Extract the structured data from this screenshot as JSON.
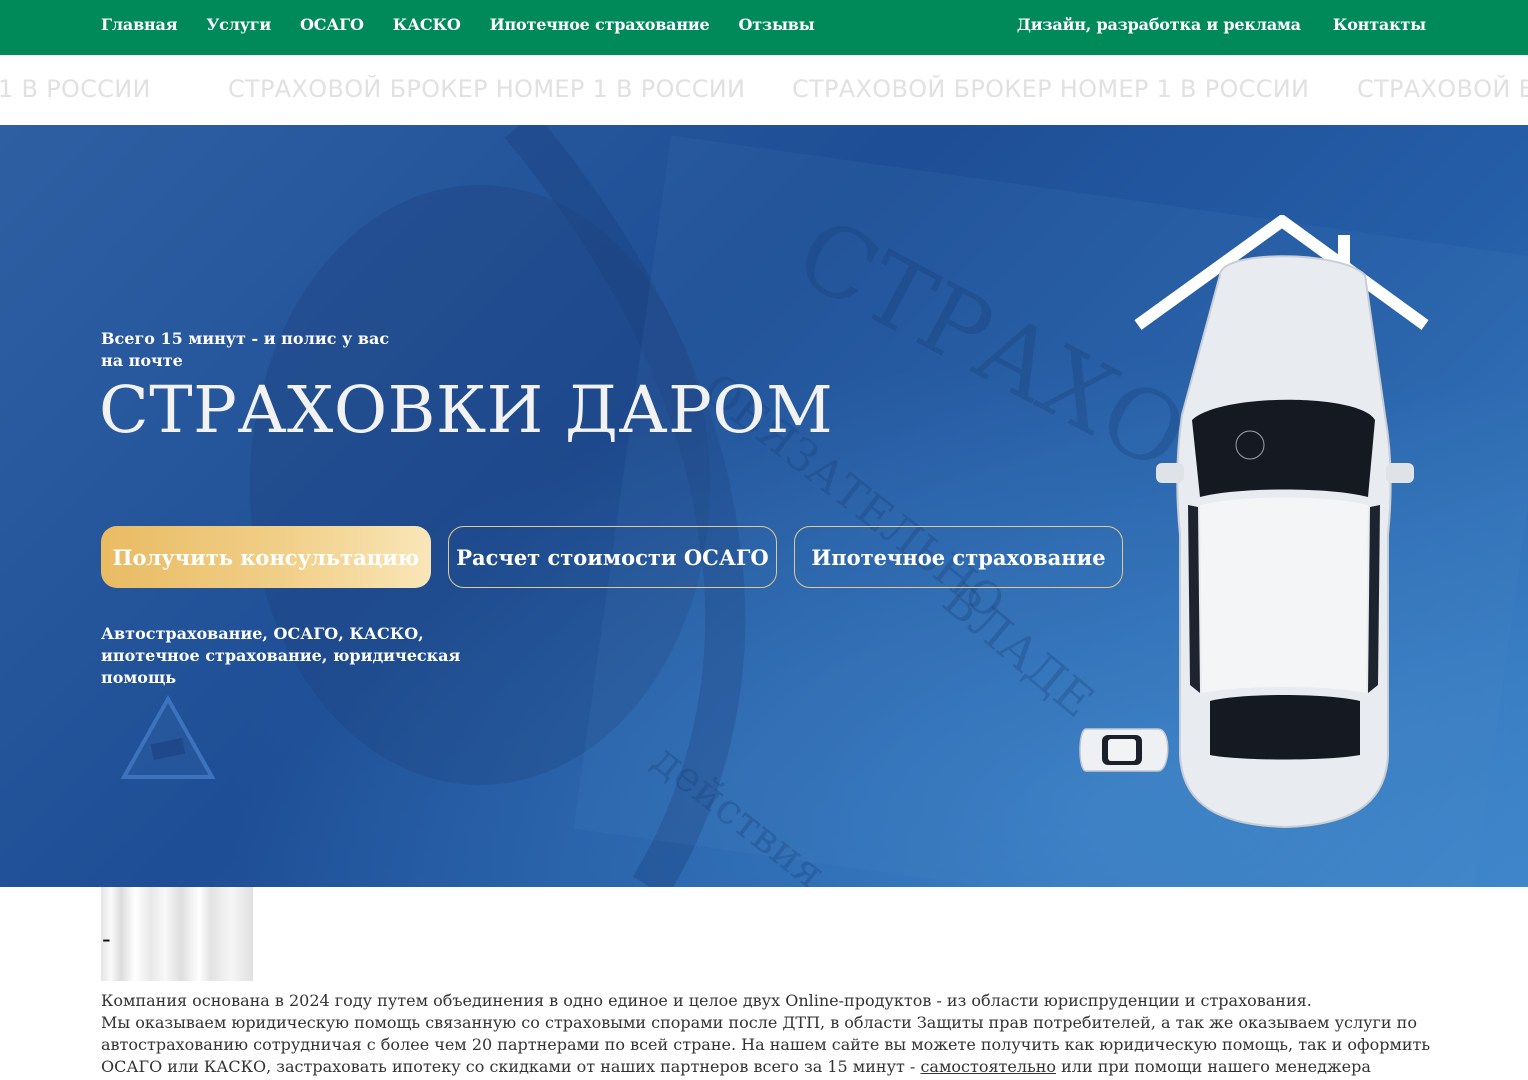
{
  "nav": {
    "left": [
      "Главная",
      "Услуги",
      "ОСАГО",
      "КАСКО",
      "Ипотечное страхование",
      "Отзывы"
    ],
    "right": [
      "Дизайн, разработка и реклама",
      "Контакты"
    ]
  },
  "ticker": {
    "items": [
      "1 В РОССИИ",
      "СТРАХОВОЙ БРОКЕР НОМЕР 1 В РОССИИ",
      "СТРАХОВОЙ БРОКЕР НОМЕР 1 В РОССИИ",
      "СТРАХОВОЙ БР"
    ]
  },
  "hero": {
    "subtitle": "Всего 15 минут - и полис у вас на почте",
    "title": "СТРАХОВКИ ДАРОМ",
    "buttons": {
      "consult": "Получить консультацию",
      "osago": "Расчет стоимости ОСАГО",
      "mortgage": "Ипотечное страхование"
    },
    "description": "Автострахование, ОСАГО, КАСКО, ипотечное страхование, юридическая помощь",
    "bg_text": [
      "СТРАХОВ",
      "ОБЯЗАТЕЛЬНО",
      "ВЛАДЕ",
      "действия"
    ]
  },
  "about": {
    "dash": "-",
    "line1": "Компания основана в 2024 году путем объединения в одно единое и целое двух Online-продуктов - из области юриспруденции и страхования.",
    "line2": "Мы оказываем юридическую помощь связанную со страховыми спорами после ДТП, в области Защиты прав потребителей, а так же оказываем услуги по автострахованию сотрудничая с более чем 20 партнерами по всей стране. На нашем сайте вы можете получить как юридическую помощь, так и оформить ОСАГО или КАСКО, застраховать ипотеку со скидками от наших партнеров всего за 15 минут -",
    "link": "самостоятельно",
    "line2_end": "или при помощи нашего менеджера"
  },
  "colors": {
    "nav_bg": "#008a5a",
    "hero_blue": "#1e4e95",
    "gold": "#e9bb63"
  }
}
